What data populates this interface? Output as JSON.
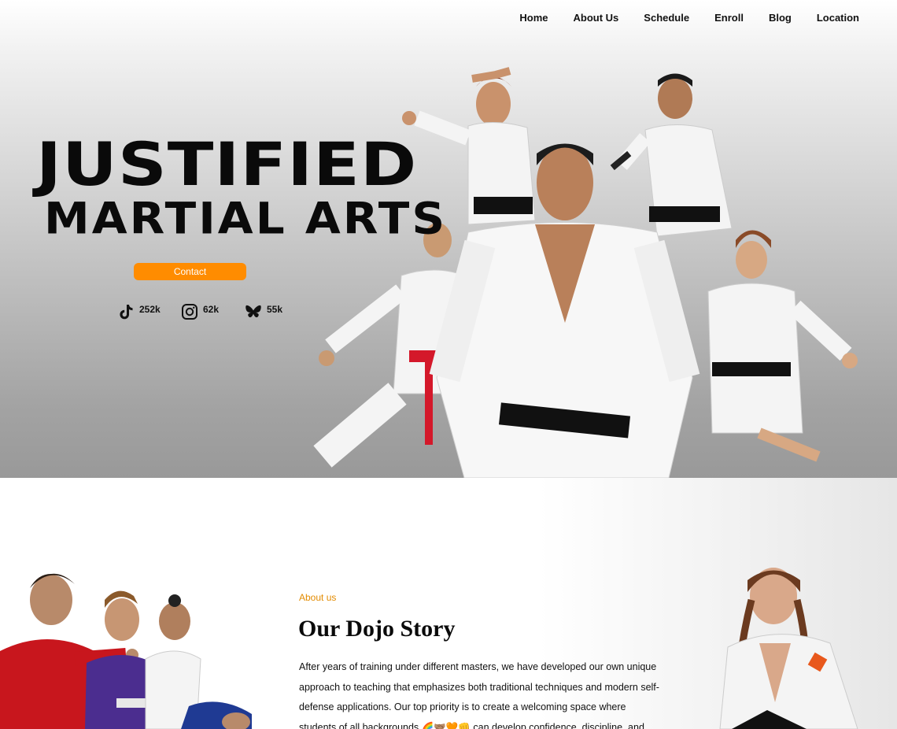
{
  "nav": {
    "items": [
      "Home",
      "About Us",
      "Schedule",
      "Enroll",
      "Blog",
      "Location"
    ]
  },
  "hero": {
    "title_line1": "JUSTIFIED",
    "title_line2": "MARTIAL ARTS",
    "contact_label": "Contact",
    "socials": [
      {
        "icon": "tiktok-icon",
        "count": "252k"
      },
      {
        "icon": "instagram-icon",
        "count": "62k"
      },
      {
        "icon": "butterfly-icon",
        "count": "55k"
      }
    ]
  },
  "about": {
    "kicker": "About us",
    "title": "Our Dojo Story",
    "body": "After years of training under different masters, we have developed our own unique approach to teaching that emphasizes both traditional techniques and modern self-defense applications. Our top priority is to create a welcoming space where students of all backgrounds 🌈🤝🏽🧡👊 can develop confidence, discipline, and respect without"
  },
  "colors": {
    "accent": "#ff8c00",
    "kicker": "#e38b00",
    "text": "#111111"
  }
}
